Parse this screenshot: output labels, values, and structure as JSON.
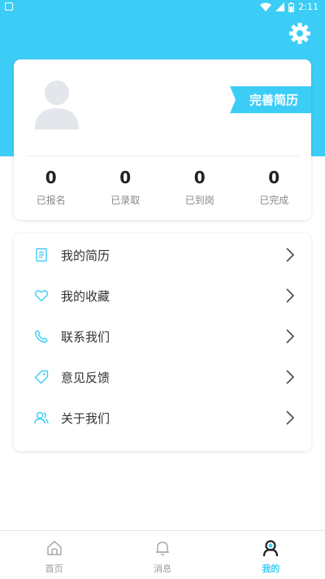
{
  "status_bar": {
    "time": "2:11"
  },
  "profile": {
    "resume_badge": "完善简历",
    "stats": [
      {
        "value": "0",
        "label": "已报名"
      },
      {
        "value": "0",
        "label": "已录取"
      },
      {
        "value": "0",
        "label": "已到岗"
      },
      {
        "value": "0",
        "label": "已完成"
      }
    ]
  },
  "menu": {
    "items": [
      {
        "label": "我的简历",
        "icon": "resume-icon"
      },
      {
        "label": "我的收藏",
        "icon": "heart-icon"
      },
      {
        "label": "联系我们",
        "icon": "phone-icon"
      },
      {
        "label": "意见反馈",
        "icon": "tag-icon"
      },
      {
        "label": "关于我们",
        "icon": "users-icon"
      }
    ]
  },
  "tabbar": {
    "tabs": [
      {
        "label": "首页",
        "icon": "home-icon"
      },
      {
        "label": "消息",
        "icon": "bell-icon"
      },
      {
        "label": "我的",
        "icon": "profile-icon",
        "active": true
      }
    ]
  },
  "colors": {
    "accent": "#3ccdf7",
    "text": "#333333",
    "muted": "#888888"
  }
}
